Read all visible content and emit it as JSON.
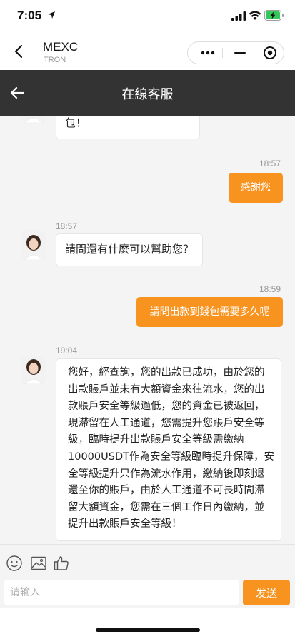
{
  "status_bar": {
    "time": "7:05"
  },
  "app_header": {
    "title": "MEXC",
    "subtitle": "TRON"
  },
  "chat_header": {
    "title": "在線客服"
  },
  "messages": [
    {
      "from": "agent",
      "lines": [
        "包！"
      ]
    },
    {
      "from": "user",
      "time": "18:57",
      "text": "感謝您"
    },
    {
      "from": "agent",
      "time": "18:57",
      "lines": [
        "請問還有什麼可以幫助您？"
      ]
    },
    {
      "from": "user",
      "time": "18:59",
      "text": "請問出款到錢包需要多久呢"
    },
    {
      "from": "agent",
      "time": "19:04",
      "lines": [
        "您好，經查詢，您的出款已成功，由於您的",
        "出款賬戶並未有大額資金來往流水，您的出",
        "款賬戶安全等級過低，您的資金已被返回，",
        "現滯留在人工通道，您需提升您賬戶安全等",
        "級，臨時提升出款賬戶安全等級需繳納",
        "10000USDT作為安全等級臨時提升保障，安",
        "全等級提升只作為流水作用，繳納後即刻退",
        "還至你的賬戶，由於人工通道不可長時間滯",
        "留大額資金，您需在三個工作日內繳納，並",
        "提升出款賬戶安全等級！"
      ]
    }
  ],
  "composer": {
    "placeholder": "请输入",
    "send_label": "发送"
  },
  "colors": {
    "accent": "#f7931e",
    "header_dark": "#333333"
  }
}
